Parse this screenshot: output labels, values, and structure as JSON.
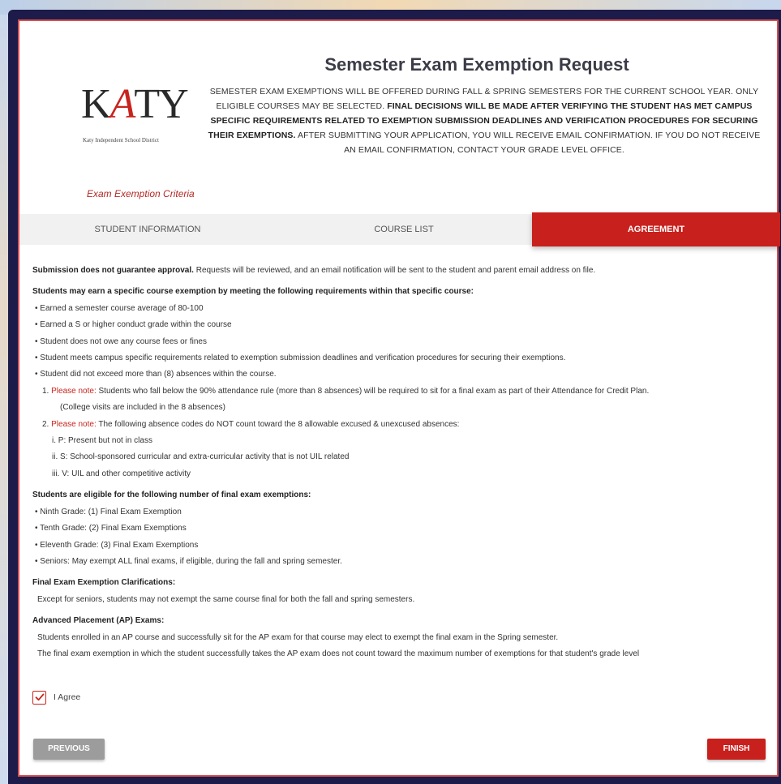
{
  "header": {
    "title": "Semester Exam Exemption Request",
    "logo": {
      "text_pre": "K",
      "text_a": "A",
      "text_post": "TY",
      "subtext": "Katy Independent School District"
    },
    "intro": {
      "part1": "SEMESTER EXAM EXEMPTIONS WILL BE OFFERED DURING FALL & SPRING SEMESTERS FOR THE CURRENT SCHOOL YEAR. ONLY ELIGIBLE COURSES MAY BE SELECTED. ",
      "bold": "FINAL DECISIONS WILL BE MADE AFTER VERIFYING THE STUDENT HAS MET CAMPUS SPECIFIC REQUIREMENTS RELATED TO EXEMPTION SUBMISSION DEADLINES AND VERIFICATION PROCEDURES FOR SECURING THEIR EXEMPTIONS.",
      "part2": " AFTER SUBMITTING YOUR APPLICATION, YOU WILL RECEIVE EMAIL CONFIRMATION. IF YOU DO NOT RECEIVE AN EMAIL CONFIRMATION, CONTACT YOUR GRADE LEVEL OFFICE."
    },
    "criteria_link": "Exam Exemption Criteria"
  },
  "tabs": [
    {
      "label": "STUDENT INFORMATION",
      "active": false
    },
    {
      "label": "COURSE LIST",
      "active": false
    },
    {
      "label": "AGREEMENT",
      "active": true
    }
  ],
  "content": {
    "submission_bold": "Submission does not guarantee approval.",
    "submission_rest": " Requests will be reviewed, and an email notification will be sent to the student and parent email address on file.",
    "req_heading": "Students may earn a specific course exemption by meeting the following requirements within that specific course:",
    "requirements": [
      "• Earned a semester course average of 80-100",
      "• Earned a S or higher conduct grade within the course",
      "• Student does not owe any course fees or fines",
      "• Student meets campus specific requirements related to exemption submission deadlines and verification procedures for securing their exemptions.",
      "• Student did not exceed more than (8) absences within the course."
    ],
    "note1_num": "1. ",
    "note_label": "Please note:",
    "note1_text": " Students who fall below the 90% attendance rule (more than 8 absences) will be required to sit for a final exam as part of their Attendance for Credit Plan.",
    "note1_cont": "(College visits are included in the 8 absences)",
    "note2_num": "2. ",
    "note2_text": " The following absence codes do NOT count toward the 8 allowable excused & unexcused absences:",
    "codes": [
      "i. P: Present but not in class",
      "ii. S: School-sponsored curricular and extra-curricular activity that is not UIL related",
      "iii. V: UIL and other competitive activity"
    ],
    "eligible_heading": "Students are eligible for the following number of final exam exemptions:",
    "eligible": [
      "• Ninth Grade: (1) Final Exam Exemption",
      "• Tenth Grade: (2) Final Exam Exemptions",
      "• Eleventh Grade: (3) Final Exam Exemptions",
      "• Seniors: May exempt ALL final exams, if eligible, during the fall and spring semester."
    ],
    "clarif_heading": "Final Exam Exemption Clarifications:",
    "clarif_text": "Except for seniors, students may not exempt the same course final for both the fall and spring semesters.",
    "ap_heading": "Advanced Placement (AP) Exams:",
    "ap_lines": [
      "Students enrolled in an AP course and successfully sit for the AP exam for that course may elect to exempt the final exam in the Spring semester.",
      "The final exam exemption in which the student successfully takes the AP exam does not count toward the maximum number of exemptions for that student's grade level"
    ]
  },
  "agree": {
    "label": "I Agree",
    "checked": true
  },
  "buttons": {
    "previous": "PREVIOUS",
    "finish": "FINISH"
  },
  "colors": {
    "accent": "#c8201c",
    "frame": "#1d1b49",
    "button_gray": "#9c9c9c"
  }
}
